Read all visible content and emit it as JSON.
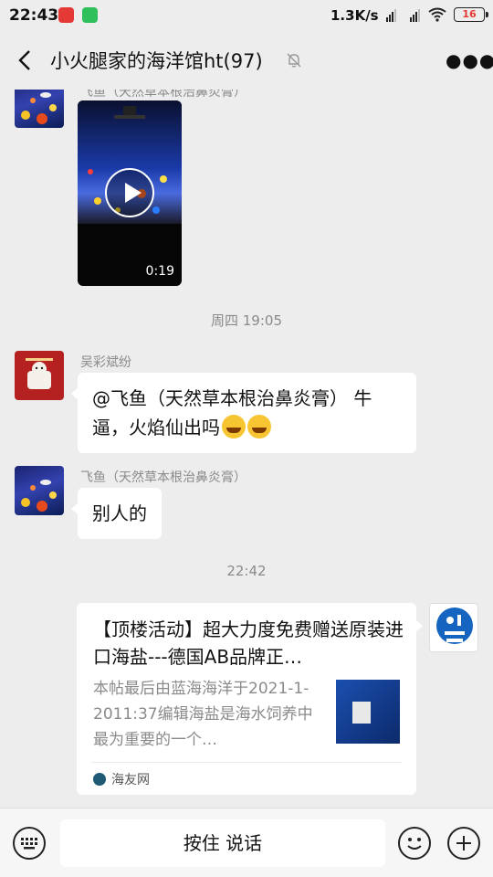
{
  "status_bar": {
    "time": "22:43",
    "speed": "1.3K/s",
    "battery": "16",
    "icons": [
      "app-red-icon",
      "app-green-icon",
      "hd-signal-icon",
      "hd-signal-icon",
      "wifi-icon",
      "battery-icon"
    ]
  },
  "header": {
    "title": "小火腿家的海洋馆ht(97)",
    "icons": [
      "back-arrow-icon",
      "mute-bell-icon",
      "more-icon"
    ]
  },
  "messages": [
    {
      "sender": "飞鱼（天然草本根治鼻炎膏）",
      "type": "video",
      "duration": "0:19"
    },
    {
      "type": "time",
      "text": "周四 19:05"
    },
    {
      "sender": "吴彩斌纷",
      "type": "text",
      "text": "@飞鱼（天然草本根治鼻炎膏） 牛逼，火焰仙出吗"
    },
    {
      "sender": "飞鱼（天然草本根治鼻炎膏）",
      "type": "text",
      "text": "别人的"
    },
    {
      "type": "time",
      "text": "22:42"
    },
    {
      "type": "link_card",
      "title": "【顶楼活动】超大力度免费赠送原装进口海盐---德国AB品牌正…",
      "desc": "本帖最后由蓝海海洋于2021-1-2011:37编辑海盐是海水饲养中最为重要的一个…",
      "source": "海友网"
    }
  ],
  "input_bar": {
    "hold_to_talk": "按住 说话",
    "icons": [
      "keyboard-icon",
      "emoji-icon",
      "plus-icon"
    ]
  },
  "colors": {
    "background": "#ededed",
    "bubble": "#ffffff",
    "meta_text": "#8a8a8a"
  }
}
